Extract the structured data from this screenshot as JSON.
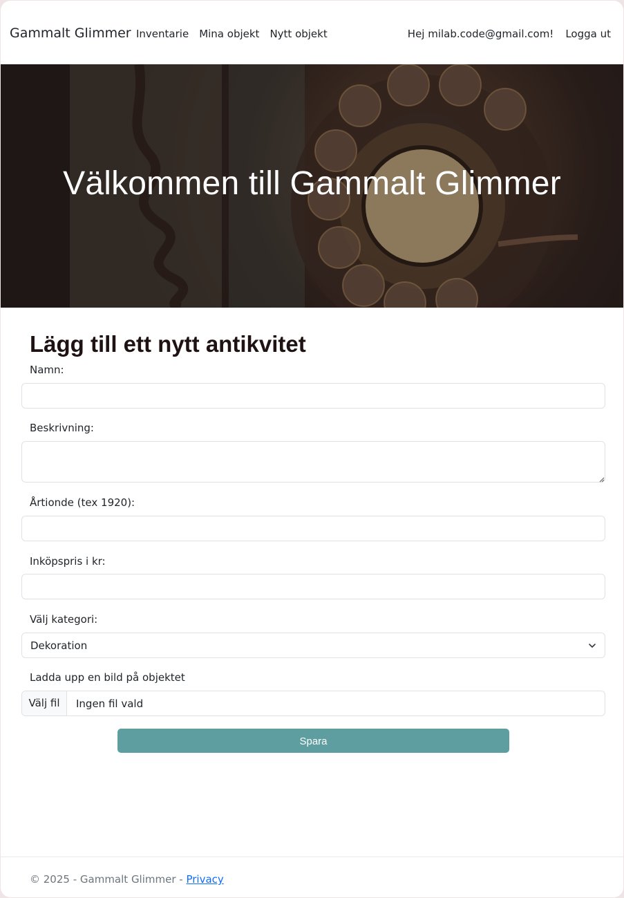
{
  "navbar": {
    "brand": "Gammalt Glimmer",
    "links": [
      "Inventarie",
      "Mina objekt",
      "Nytt objekt"
    ],
    "greeting": "Hej milab.code@gmail.com!",
    "logout": "Logga ut"
  },
  "hero": {
    "title": "Välkommen till Gammalt Glimmer"
  },
  "form": {
    "heading": "Lägg till ett nytt antikvitet",
    "name_label": "Namn:",
    "name_value": "",
    "description_label": "Beskrivning:",
    "description_value": "",
    "decade_label": "Årtionde (tex 1920):",
    "decade_value": "",
    "price_label": "Inköpspris i kr:",
    "price_value": "",
    "category_label": "Välj kategori:",
    "category_selected": "Dekoration",
    "upload_label": "Ladda upp en bild på objektet",
    "file_button": "Välj fil",
    "file_status": "Ingen fil vald",
    "save_label": "Spara"
  },
  "footer": {
    "copyright": "© 2025 - Gammalt Glimmer - ",
    "privacy_link": "Privacy"
  },
  "colors": {
    "accent": "#5f9ea0",
    "link": "#0d6efd",
    "heading": "#1f1212"
  },
  "icons": {
    "select": "chevron-down-icon",
    "textarea": "resize-grip-icon"
  }
}
